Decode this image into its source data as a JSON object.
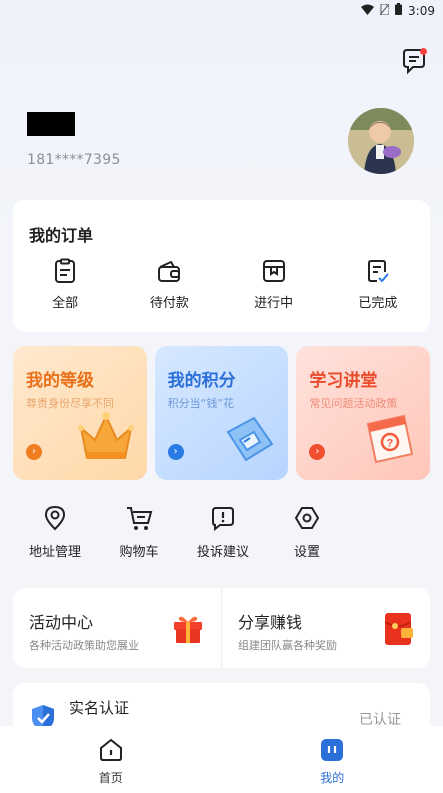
{
  "status_bar": {
    "time": "3:09"
  },
  "profile": {
    "phone": "181****7395"
  },
  "orders": {
    "title": "我的订单",
    "items": [
      {
        "label": "全部",
        "icon": "clipboard-icon"
      },
      {
        "label": "待付款",
        "icon": "wallet-icon"
      },
      {
        "label": "进行中",
        "icon": "box-icon"
      },
      {
        "label": "已完成",
        "icon": "checked-doc-icon"
      }
    ]
  },
  "tiles": [
    {
      "title": "我的等级",
      "subtitle": "尊贵身份尽享不同",
      "icon": "crown-icon"
    },
    {
      "title": "我的积分",
      "subtitle": "积分当“钱”花",
      "icon": "points-card-icon"
    },
    {
      "title": "学习讲堂",
      "subtitle": "常见问题活动政策",
      "icon": "calendar-question-icon"
    }
  ],
  "tools": [
    {
      "label": "地址管理",
      "icon": "location-pin-icon"
    },
    {
      "label": "购物车",
      "icon": "cart-icon"
    },
    {
      "label": "投诉建议",
      "icon": "feedback-icon"
    },
    {
      "label": "设置",
      "icon": "settings-hexagon-icon"
    }
  ],
  "promo": [
    {
      "title": "活动中心",
      "subtitle": "各种活动政策助您展业",
      "icon": "gift-icon"
    },
    {
      "title": "分享赚钱",
      "subtitle": "组建团队赢各种奖励",
      "icon": "red-envelope-icon"
    }
  ],
  "verify": {
    "title": "实名认证",
    "status": "已认证"
  },
  "tabbar": [
    {
      "label": "首页",
      "icon": "home-icon"
    },
    {
      "label": "我的",
      "icon": "profile-icon"
    }
  ],
  "colors": {
    "accent_blue": "#2b6fd9",
    "level_orange": "#e8701a",
    "study_red": "#e94b2a"
  }
}
